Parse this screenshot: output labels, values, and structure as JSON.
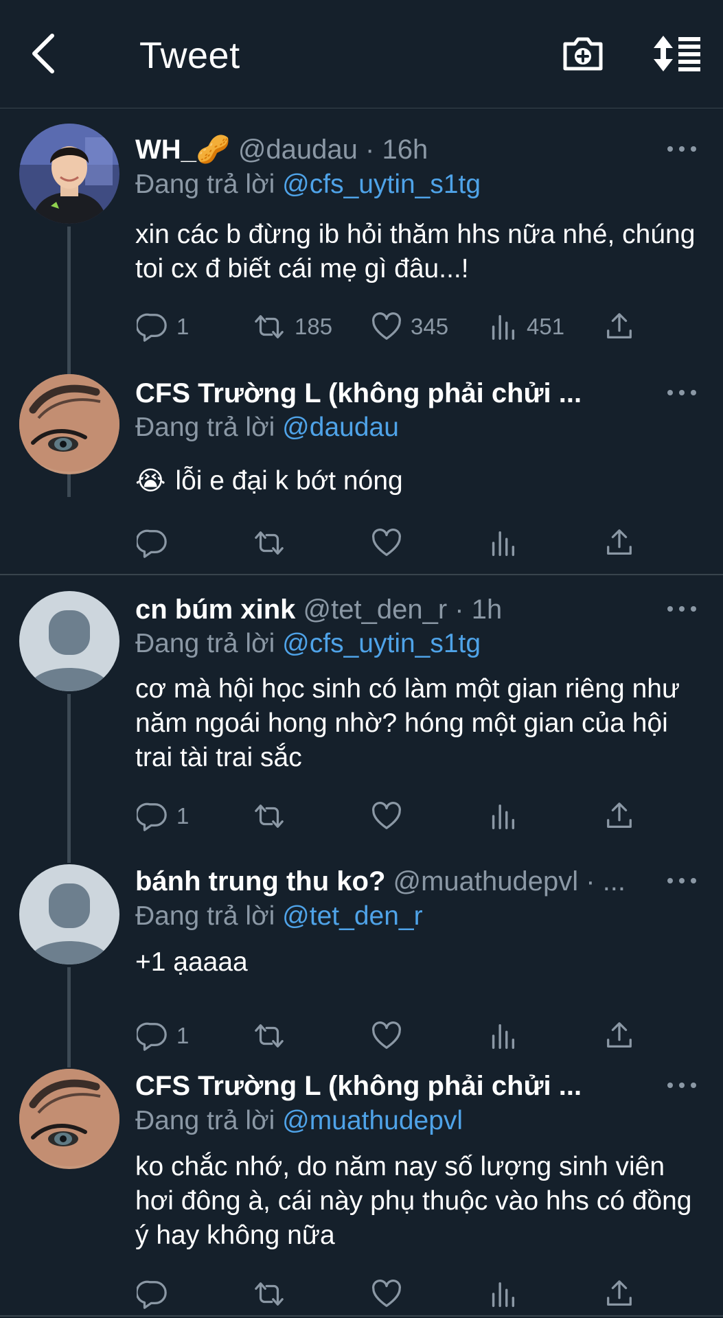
{
  "header": {
    "title": "Tweet",
    "back_icon": "chevron-left-icon",
    "camera_icon": "camera-plus-icon",
    "sort_icon": "sort-list-icon"
  },
  "colors": {
    "background": "#15202b",
    "secondary_text": "#8b98a5",
    "mention": "#4fa3e8",
    "divider": "#38444d"
  },
  "tweets": [
    {
      "name": "WH_🥜",
      "meta": "@daudau · 16h",
      "reply_prefix": "Đang trả lời",
      "reply_to": "@cfs_uytin_s1tg",
      "text": "xin các b đừng ib hỏi thăm hhs nữa nhé, chúng toi cx đ biết cái mẹ gì đâu...!",
      "reply_count": "1",
      "retweet_count": "185",
      "like_count": "345",
      "view_count": "451"
    },
    {
      "name": "CFS Trường L (không phải chửi ...",
      "meta": "",
      "reply_prefix": "Đang trả lời",
      "reply_to": "@daudau",
      "emoji": "😭",
      "text": "lỗi e đại k bớt nóng",
      "reply_count": "",
      "retweet_count": "",
      "like_count": "",
      "view_count": ""
    },
    {
      "name": "cn búm xink",
      "meta": "@tet_den_r · 1h",
      "reply_prefix": "Đang trả lời",
      "reply_to": "@cfs_uytin_s1tg",
      "text": "cơ mà hội học sinh có làm một gian riêng như năm ngoái hong nhờ? hóng một gian của hội trai tài trai sắc",
      "reply_count": "1",
      "retweet_count": "",
      "like_count": "",
      "view_count": ""
    },
    {
      "name": "bánh trung thu ko?",
      "meta": "@muathudepvl · ...",
      "reply_prefix": "Đang trả lời",
      "reply_to": "@tet_den_r",
      "text": "+1 ạaaaa",
      "reply_count": "1",
      "retweet_count": "",
      "like_count": "",
      "view_count": ""
    },
    {
      "name": "CFS Trường L (không phải chửi ...",
      "meta": "",
      "reply_prefix": "Đang trả lời",
      "reply_to": "@muathudepvl",
      "text": "ko chắc nhớ, do năm nay số lượng sinh viên hơi đông à, cái này phụ thuộc vào hhs có đồng ý hay không nữa",
      "reply_count": "",
      "retweet_count": "",
      "like_count": "",
      "view_count": ""
    }
  ]
}
